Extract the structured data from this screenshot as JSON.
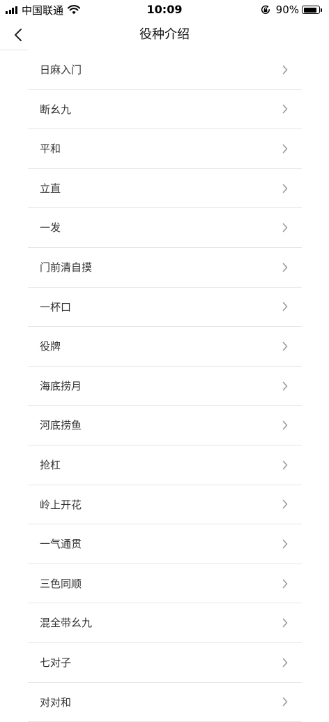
{
  "status_bar": {
    "carrier": "中国联通",
    "time": "10:09",
    "battery_percent_text": "90%",
    "battery_level": 0.9
  },
  "nav": {
    "title": "役种介绍"
  },
  "colors": {
    "background": "#ffffff",
    "divider": "#e6e6e6",
    "item_text": "#333333",
    "chevron": "#999999"
  },
  "icons": {
    "back": "chevron-left-icon",
    "row": "chevron-right-icon"
  },
  "yaku_list": [
    {
      "label": "日麻入门"
    },
    {
      "label": "断幺九"
    },
    {
      "label": "平和"
    },
    {
      "label": "立直"
    },
    {
      "label": "一发"
    },
    {
      "label": "门前清自摸"
    },
    {
      "label": "一杯口"
    },
    {
      "label": "役牌"
    },
    {
      "label": "海底捞月"
    },
    {
      "label": "河底捞鱼"
    },
    {
      "label": "抢杠"
    },
    {
      "label": "岭上开花"
    },
    {
      "label": "一气通贯"
    },
    {
      "label": "三色同顺"
    },
    {
      "label": "混全带幺九"
    },
    {
      "label": "七对子"
    },
    {
      "label": "对对和"
    }
  ]
}
